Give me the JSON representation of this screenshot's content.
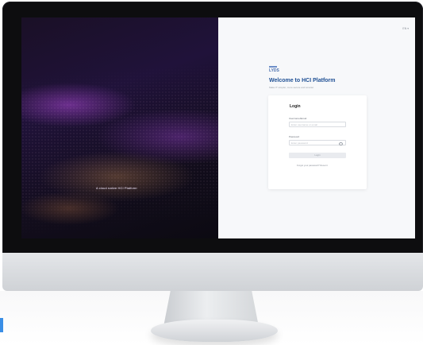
{
  "hero": {
    "caption": "A cloud native HCI Platform"
  },
  "login_page": {
    "language": "EN ▾",
    "logo_text": "LYDS",
    "welcome_title": "Welcome to HCI Platform",
    "welcome_subtitle": "Make IT simpler, more secure and smarter",
    "card": {
      "title": "Login",
      "username_label": "Username/Email",
      "username_placeholder": "Enter username or email",
      "password_label": "Password",
      "password_placeholder": "Enter password",
      "login_button": "Login",
      "help_text": "Forgot your password? Reset it"
    }
  },
  "colors": {
    "accent": "#1e4f94",
    "hero_purple": "#8a3cc4",
    "card_bg": "#ffffff"
  }
}
